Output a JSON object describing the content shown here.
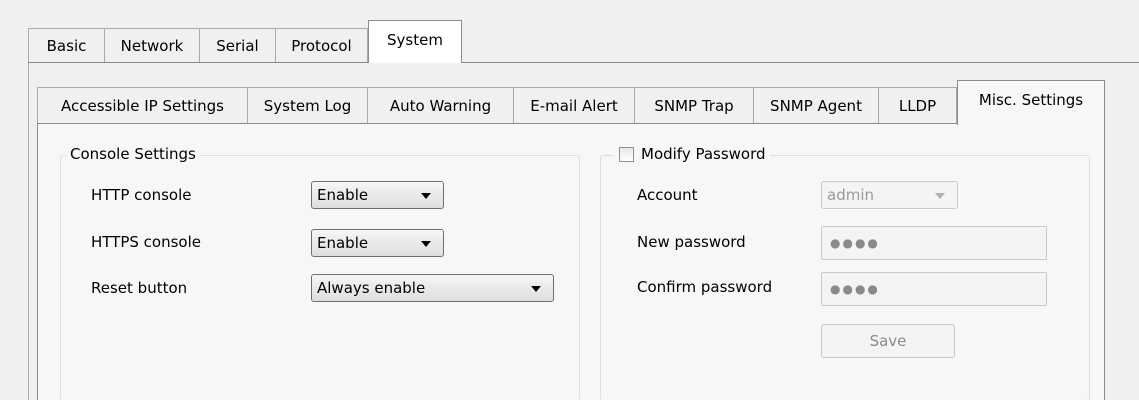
{
  "top_tabs": [
    "Basic",
    "Network",
    "Serial",
    "Protocol",
    "System"
  ],
  "sub_tabs": [
    "Accessible IP Settings",
    "System Log",
    "Auto Warning",
    "E-mail Alert",
    "SNMP Trap",
    "SNMP Agent",
    "LLDP",
    "Misc. Settings"
  ],
  "console": {
    "title": "Console Settings",
    "http_label": "HTTP console",
    "http_value": "Enable",
    "https_label": "HTTPS console",
    "https_value": "Enable",
    "reset_label": "Reset button",
    "reset_value": "Always enable"
  },
  "password": {
    "checkbox_label": "Modify Password",
    "checked": false,
    "account_label": "Account",
    "account_value": "admin",
    "new_label": "New password",
    "new_value": "●●●●",
    "confirm_label": "Confirm password",
    "confirm_value": "●●●●",
    "save_label": "Save"
  }
}
